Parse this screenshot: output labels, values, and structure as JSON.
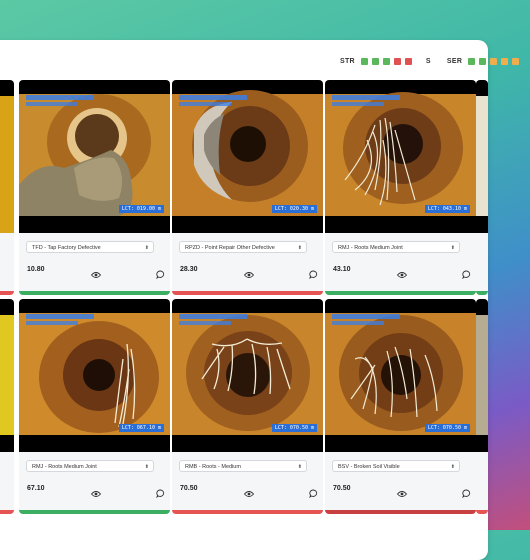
{
  "legend": {
    "str_label": "STR",
    "str_colors": [
      "#5bb75b",
      "#5bb75b",
      "#5bb75b",
      "#e05252",
      "#e05252"
    ],
    "s_label": "S",
    "ser_label": "SER",
    "ser_colors": [
      "#5bb75b",
      "#5bb75b",
      "#f0ad4e",
      "#f0ad4e",
      "#f0ad4e"
    ]
  },
  "cards": [
    {
      "defect": "TFD - Tap Factory Defective",
      "score": "10.80",
      "meter": "LCT: 019.00 m",
      "status_color": "#3cae62"
    },
    {
      "defect": "RPZD - Point Repair Other Defective",
      "score": "28.30",
      "meter": "LCT: 020.30 m",
      "status_color": "#e55353"
    },
    {
      "defect": "RMJ - Roots Medium Joint",
      "score": "43.10",
      "meter": "LCT: 043.10 m",
      "status_color": "#3cae62"
    },
    {
      "defect": "RMJ - Roots Medium Joint",
      "score": "67.10",
      "meter": "LCT: 067.10 m",
      "status_color": "#3cae62"
    },
    {
      "defect": "RMB - Roots - Medium",
      "score": "70.50",
      "meter": "LCT: 070.50 m",
      "status_color": "#e55353"
    },
    {
      "defect": "BSV - Broken Soil Visible",
      "score": "70.50",
      "meter": "LCT: 070.50 m",
      "status_color": "#c94040"
    }
  ],
  "icons": {
    "view": "eye-icon",
    "comment": "chat-bubble-icon",
    "select": "chevron-updown-icon"
  }
}
